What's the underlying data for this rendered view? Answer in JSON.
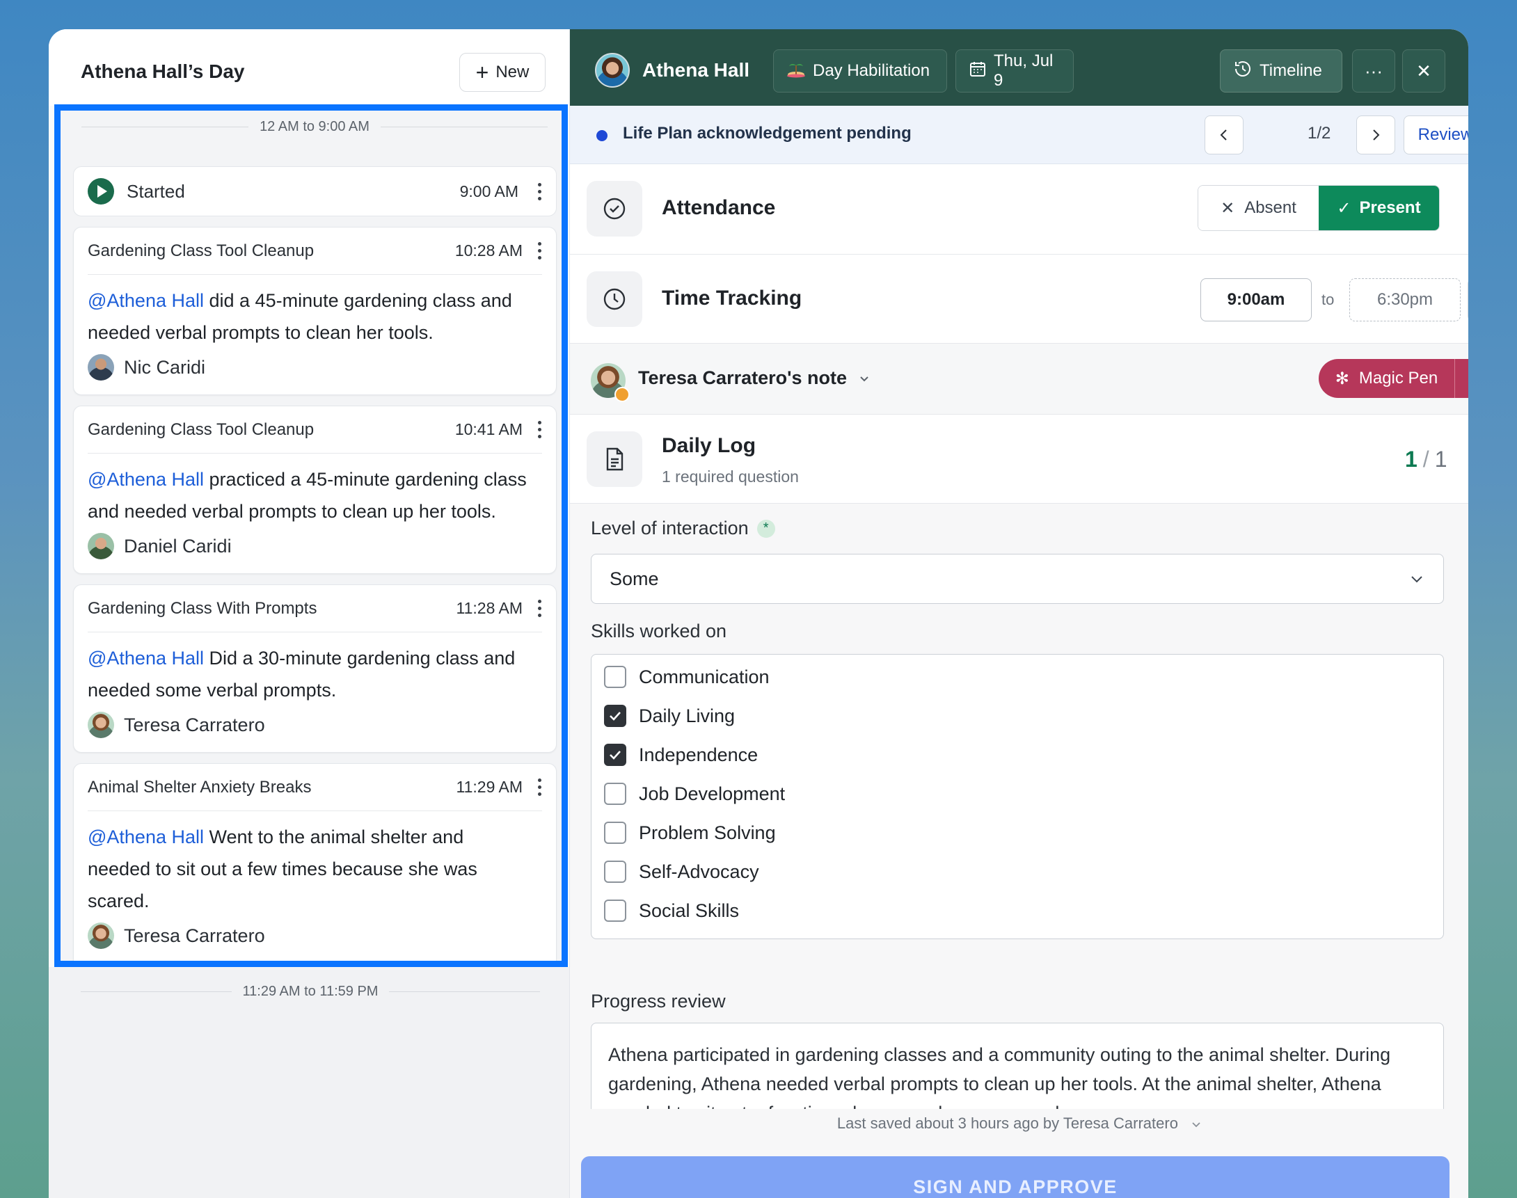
{
  "left": {
    "title": "Athena Hall’s Day",
    "new_label": "New",
    "range_top": "12 AM to 9:00 AM",
    "range_bottom": "11:29 AM to 11:59 PM",
    "started": {
      "label": "Started",
      "time": "9:00 AM"
    },
    "entries": [
      {
        "title": "Gardening Class Tool Cleanup",
        "time": "10:28 AM",
        "mention": "@Athena Hall",
        "text": " did a 45-minute gardening class and needed verbal prompts to clean her tools.",
        "author": "Nic Caridi"
      },
      {
        "title": "Gardening Class Tool Cleanup",
        "time": "10:41 AM",
        "mention": "@Athena Hall",
        "text": " practiced a 45-minute gardening class and needed verbal prompts to clean up her tools.",
        "author": "Daniel Caridi"
      },
      {
        "title": "Gardening Class With Prompts",
        "time": "11:28 AM",
        "mention": "@Athena Hall",
        "text": " Did a 30-minute gardening class and needed some verbal prompts.",
        "author": "Teresa Carratero"
      },
      {
        "title": "Animal Shelter Anxiety Breaks",
        "time": "11:29 AM",
        "mention": "@Athena Hall",
        "text": " Went to the animal shelter and needed to sit out a few times because she was scared.",
        "author": "Teresa Carratero"
      }
    ]
  },
  "topbar": {
    "person": "Athena Hall",
    "program": "Day Habilitation",
    "date": "Thu, Jul 9",
    "timeline": "Timeline",
    "more": "···",
    "close": "✕"
  },
  "ack": {
    "text": "Life Plan acknowledgement pending",
    "pager": "1/2",
    "review": "Review"
  },
  "attendance": {
    "title": "Attendance",
    "absent": "Absent",
    "present": "Present"
  },
  "time_tracking": {
    "title": "Time Tracking",
    "start": "9:00am",
    "to": "to",
    "end": "6:30pm"
  },
  "note": {
    "title": "Teresa Carratero's note",
    "magic_pen": "Magic Pen"
  },
  "daily_log": {
    "title": "Daily Log",
    "subtitle": "1 required question",
    "count_done": "1",
    "count_sep": "/",
    "count_total": "1"
  },
  "form": {
    "interaction_label": "Level of interaction",
    "interaction_value": "Some",
    "skills_label": "Skills worked on",
    "skills": [
      {
        "label": "Communication",
        "checked": false
      },
      {
        "label": "Daily Living",
        "checked": true
      },
      {
        "label": "Independence",
        "checked": true
      },
      {
        "label": "Job Development",
        "checked": false
      },
      {
        "label": "Problem Solving",
        "checked": false
      },
      {
        "label": "Self-Advocacy",
        "checked": false
      },
      {
        "label": "Social Skills",
        "checked": false
      }
    ],
    "progress_label": "Progress review",
    "progress_text": "Athena participated in gardening classes and a community outing to the animal shelter. During gardening, Athena needed verbal prompts to clean up her tools. At the animal shelter, Athena needed to sit out a few times because she was scared.",
    "saved": "Last saved about 3 hours ago by Teresa Carratero",
    "sign": "SIGN AND APPROVE"
  },
  "colors": {
    "highlight": "#0a74ff",
    "topbar": "#285046",
    "present": "#0d8a5b",
    "magic_pen": "#b6375a",
    "sign": "#7fa3f5",
    "mention": "#1d5ed8"
  }
}
